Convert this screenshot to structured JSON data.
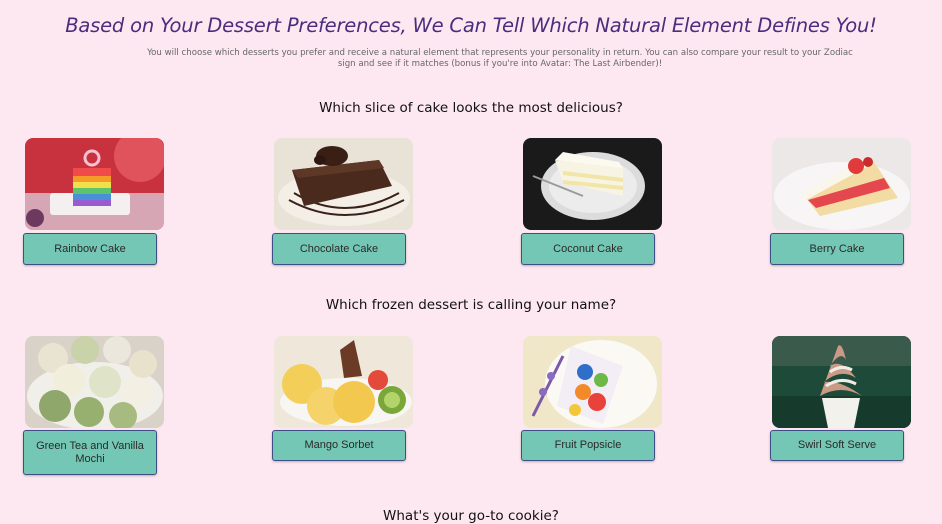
{
  "page": {
    "title": "Based on Your Dessert Preferences, We Can Tell Which Natural Element Defines You!",
    "description": "You will choose which desserts you prefer and receive a natural element that represents your personality in return. You can also compare your result to your Zodiac sign and see if it matches (bonus if you're into Avatar: The Last Airbender)!"
  },
  "questions": [
    {
      "text": "Which slice of cake looks the most delicious?",
      "options": [
        {
          "label": "Rainbow Cake",
          "image": "rainbow-cake-photo"
        },
        {
          "label": "Chocolate Cake",
          "image": "chocolate-cake-photo"
        },
        {
          "label": "Coconut Cake",
          "image": "coconut-cake-photo"
        },
        {
          "label": "Berry Cake",
          "image": "berry-cake-photo"
        }
      ]
    },
    {
      "text": "Which frozen dessert is calling your name?",
      "options": [
        {
          "label": "Green Tea and Vanilla Mochi",
          "image": "mochi-photo"
        },
        {
          "label": "Mango Sorbet",
          "image": "mango-sorbet-photo"
        },
        {
          "label": "Fruit Popsicle",
          "image": "fruit-popsicle-photo"
        },
        {
          "label": "Swirl Soft Serve",
          "image": "soft-serve-photo"
        }
      ]
    },
    {
      "text": "What's your go-to cookie?"
    }
  ],
  "colors": {
    "background": "#fde8f1",
    "title": "#4a2d7e",
    "button": "#74c7b4",
    "button_border": "#3e4f86"
  }
}
